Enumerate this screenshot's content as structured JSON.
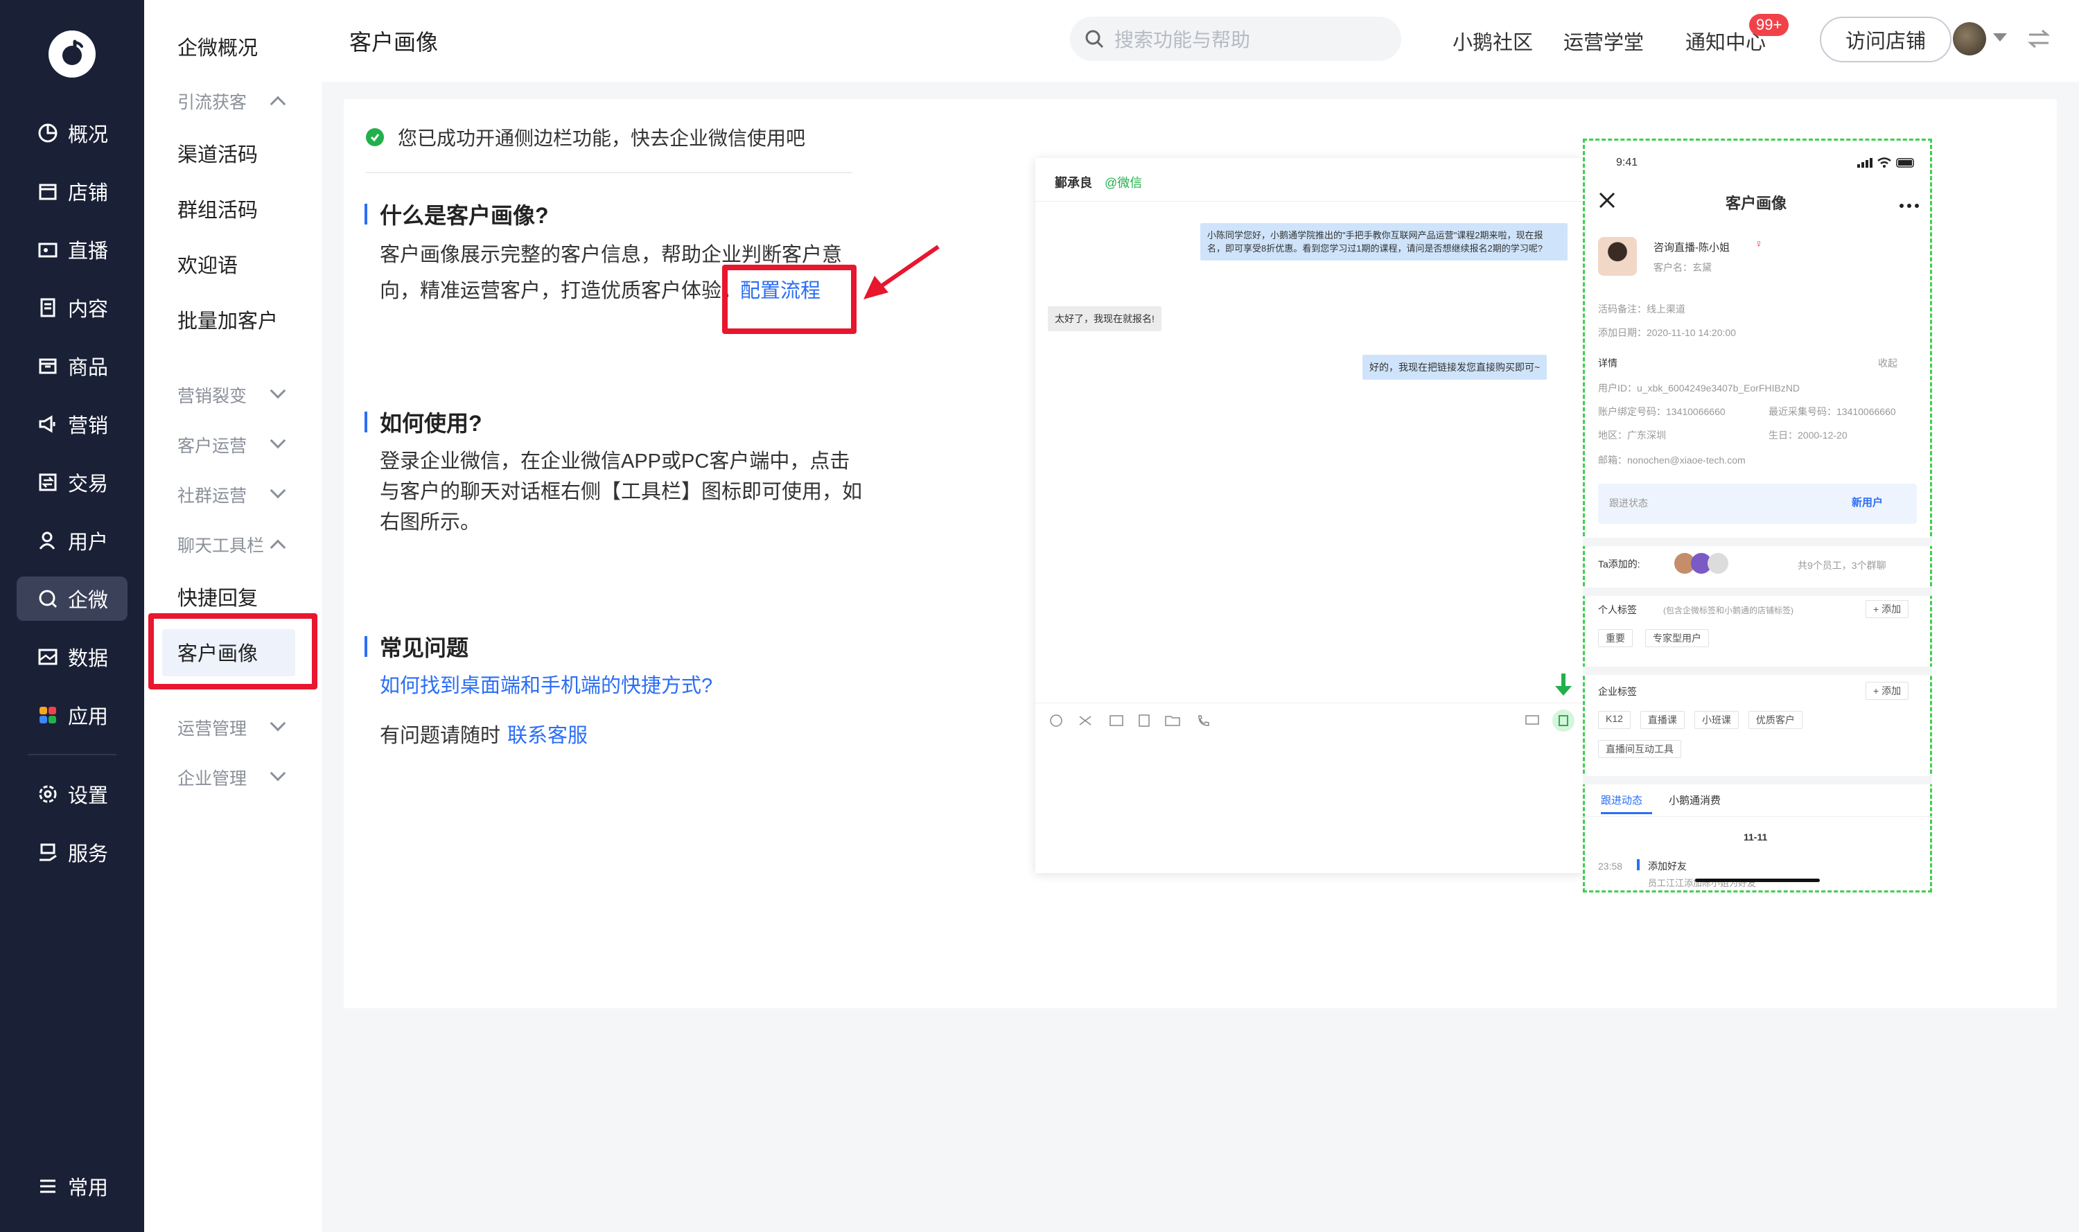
{
  "rail": {
    "items": [
      {
        "label": "概况",
        "icon": "pie-chart-icon"
      },
      {
        "label": "店铺",
        "icon": "store-icon"
      },
      {
        "label": "直播",
        "icon": "live-camera-icon"
      },
      {
        "label": "内容",
        "icon": "document-icon"
      },
      {
        "label": "商品",
        "icon": "product-box-icon"
      },
      {
        "label": "营销",
        "icon": "megaphone-icon"
      },
      {
        "label": "交易",
        "icon": "transaction-icon"
      },
      {
        "label": "用户",
        "icon": "user-icon"
      },
      {
        "label": "企微",
        "icon": "wecom-chat-icon"
      },
      {
        "label": "数据",
        "icon": "data-image-icon"
      },
      {
        "label": "应用",
        "icon": "apps-grid-icon"
      },
      {
        "label": "设置",
        "icon": "gear-icon"
      },
      {
        "label": "服务",
        "icon": "service-hand-icon"
      }
    ],
    "bottom": {
      "label": "常用",
      "icon": "list-menu-icon"
    }
  },
  "sub": {
    "overview": "企微概况",
    "g1": "引流获客",
    "i1": "渠道活码",
    "i2": "群组活码",
    "i3": "欢迎语",
    "i4": "批量加客户",
    "g2": "营销裂变",
    "g3": "客户运营",
    "g4": "社群运营",
    "g5": "聊天工具栏",
    "i5": "快捷回复",
    "i6": "客户画像",
    "g6": "运营管理",
    "g7": "企业管理"
  },
  "header": {
    "title": "客户画像",
    "search_placeholder": "搜索功能与帮助",
    "community": "小鹅社区",
    "academy": "运营学堂",
    "notifications": "通知中心",
    "badge": "99+",
    "visit": "访问店铺"
  },
  "main": {
    "tip": "您已成功开通侧边栏功能，快去企业微信使用吧",
    "sec1_title": "什么是客户画像?",
    "sec1_line1": "客户画像展示完整的客户信息，帮助企业判断客户意",
    "sec1_line2": "向，精准运营客户，打造优质客户体验。",
    "sec1_link": "配置流程",
    "sec2_title": "如何使用?",
    "sec2_line1": "登录企业微信，在企业微信APP或PC客户端中，点击",
    "sec2_line2": "与客户的聊天对话框右侧【工具栏】图标即可使用，如",
    "sec2_line3": "右图所示。",
    "sec3_title": "常见问题",
    "faq_link": "如何找到桌面端和手机端的快捷方式?",
    "contact_text": "有问题请随时",
    "contact_link": "联系客服"
  },
  "pc": {
    "name": "鄞承良",
    "wx": "@微信",
    "msg1": "小陈同学您好，小鹅通学院推出的\"手把手教你互联网产品运营\"课程2期来啦，现在报名，即可享受8折优惠。看到您学习过1期的课程，请问是否想继续报名2期的学习呢?",
    "msg2": "太好了，我现在就报名!",
    "msg3": "好的，我现在把链接发您直接购买即可~"
  },
  "phone": {
    "time": "9:41",
    "title": "客户画像",
    "name": "咨询直播-陈小姐",
    "customer": "客户名：玄黛",
    "remark": "活码备注：线上渠道",
    "added": "添加日期：2020-11-10  14:20:00",
    "detail": "详情",
    "collapse": "收起",
    "uid": "用户ID：u_xbk_6004249e3407b_EorFHIBzND",
    "bind_phone": "账户绑定号码：13410066660",
    "recent_phone": "最近采集号码：13410066660",
    "region": "地区：广东深圳",
    "birthday": "生日：2000-12-20",
    "email": "邮箱：nonochen@xiaoe-tech.com",
    "follow": "跟进状态",
    "new_user": "新用户",
    "ta_added": "Ta添加的:",
    "ta_summary": "共9个员工，3个群聊",
    "personal_tags": "个人标签",
    "personal_hint": "(包含企微标签和小鹅通的店铺标签)",
    "add": "+ 添加",
    "ptags": [
      "重要",
      "专家型用户"
    ],
    "corp_tags": "企业标签",
    "ctags": [
      "K12",
      "直播课",
      "小班课",
      "优质客户",
      "直播间互动工具"
    ],
    "tab1": "跟进动态",
    "tab2": "小鹅通消费",
    "date": "11-11",
    "log_time": "23:58",
    "log_title": "添加好友",
    "log_sub": "员工江江添加陈小姐为好友"
  }
}
